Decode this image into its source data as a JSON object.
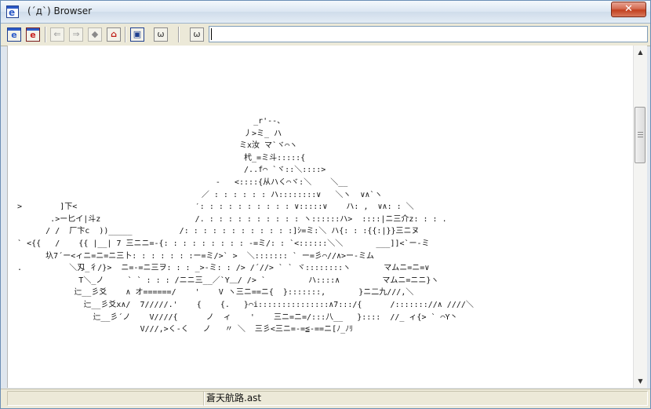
{
  "window": {
    "title": "(´д`) Browser",
    "close_glyph": "✕"
  },
  "toolbar": {
    "buttons": [
      {
        "name": "open-e-icon",
        "glyph": "e"
      },
      {
        "name": "open-e-red-icon",
        "glyph": "e"
      },
      {
        "name": "back-icon",
        "glyph": "⇐"
      },
      {
        "name": "forward-icon",
        "glyph": "⇒"
      },
      {
        "name": "stop-icon",
        "glyph": "◆"
      },
      {
        "name": "home-icon",
        "glyph": "⌂"
      },
      {
        "name": "favorites-icon",
        "glyph": "▣"
      },
      {
        "name": "face-icon",
        "glyph": "ω"
      },
      {
        "name": "face-small-icon",
        "glyph": "ω"
      }
    ],
    "address_value": ""
  },
  "content": {
    "ascii_art": "                                                    _r'--、\n                                                  丿>ミ_ ハ\n                                                 ミx汝 マ`ヾ⌒ヽ\n                                                  杙_=ミ斗:::::{\n                                                  /..f⌒ `ヾ::＼::::>\n                                            -   <::::{从ハく⌒ヾ:＼    ＼__\n                                         ／ : : : : : : ハ::::::::∨   ＼ヽ  ∨∧`ヽ\n  >        ]下<                         ′: : : : : : : : : : ∨:::::∨    ハ: ,  ∨∧: : ＼\n         .>ー匕イ|斗z                    /. : : : : : : : : : : ヽ::::::ハ>  ::::|ニ三介z: : : .\n        / /  厂卞c  ))_____          /: : : : : : : : : : : :]ｼ=ミ:＼ ハ{: : :{{:|}}三ニヌ\n  ` <{{   /    {{ |_̲| 7 ̄三ニニ=-{: : : : : : : : : -=ミ/: : `<::::::＼＼       ___]]<`ー-ミ\n        圦7´ー<ィニ=ニ=ニ三卜: : : : : : :ー=ミ/>` >  ＼::::::: ` ー=彡⌒//∧>ー-ミム\n  .          ＼刄_彳/}>  ニ=-=ニ三ヲ: : : _>-ミ: : /> /´//> ` ` ヾ::::::::ヽ       マムニ=ニ=∨\n               T＼_ノ     ` ` : : : ∕ニニ三__／`Y＿/ /> `         ハ::::∧         マムニ=ニニ}ヽ\n              辷__彡爻    ∧ オ======/    '    V ヽ三ニ==ニ{  }:::::::,       }ニ二九///,＼\n                辷__彡爻x∧/  7/////.'    {    {.   }⌒i:::::::::::::::∧7:::/{      /::::::://∧ ////＼\n                  辷__彡´ノ    V////{      ノ  ィ    '    三ニ=ニ=/:::八__   }::::  //_ ィ{> ` ⌒Y丶\n                            V///,>く-く   ノ   〃 ＼  三彡<三ニ=-=≦-==ニ[ﾉ_ﾉﾘ"
  },
  "status": {
    "left": "",
    "file_name": "蒼天航路.ast"
  }
}
